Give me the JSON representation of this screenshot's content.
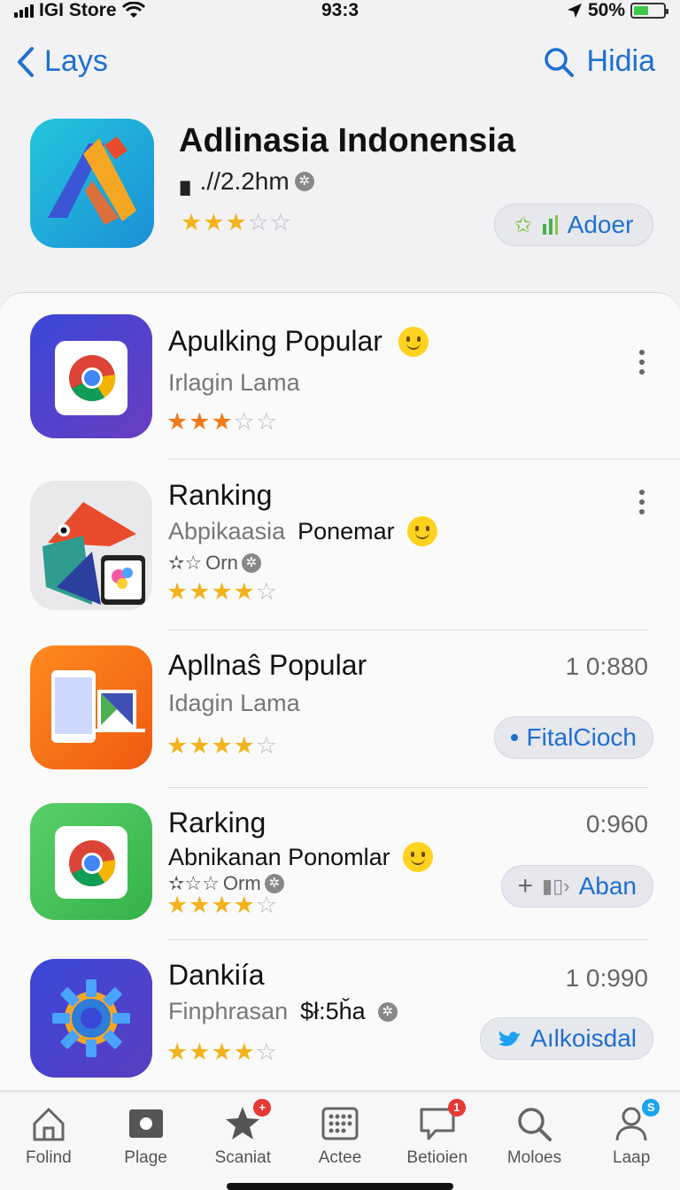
{
  "status": {
    "carrier": "IGI Store",
    "time": "93:3",
    "battery": "50%",
    "battery_level": 0.5
  },
  "nav": {
    "back_label": "Lays",
    "search_label": "Hidia"
  },
  "featured": {
    "title": "Adlinasia Indonensia",
    "meta": "▖.//2.2hm",
    "rating": 3,
    "button_label": "Adoer"
  },
  "rows": [
    {
      "title": "Apulking Popular",
      "subtitle": "Irlagin Lama",
      "rating": 3,
      "rating_color": "#f07a1a"
    },
    {
      "title": "Ranking",
      "subtitle": "Abpikaasia",
      "subtitle_dark": "Ponemar",
      "sub2": "Orn",
      "rating": 4
    },
    {
      "title": "Apllnaŝ Popular",
      "subtitle": "Idagin Lama",
      "time": "1 0:880",
      "button_label": "FitalCioch",
      "rating": 4
    },
    {
      "title": "Rarking",
      "subtitle": "Abnikanan Ponomlar",
      "sub2": "Orm",
      "time": "0:960",
      "button_label": "Aban",
      "rating": 4
    },
    {
      "title": "Dankiía",
      "subtitle": "Finphrasan",
      "subtitle_dark": "$ł:5ȟa",
      "time": "1 0:990",
      "button_label": "Aılkoisdal",
      "rating": 4
    }
  ],
  "tabs": [
    {
      "label": "Folind",
      "icon": "home-icon"
    },
    {
      "label": "Plage",
      "icon": "photo-icon"
    },
    {
      "label": "Scaniat",
      "icon": "star-icon",
      "badge": "+"
    },
    {
      "label": "Actee",
      "icon": "grid-icon"
    },
    {
      "label": "Betioien",
      "icon": "message-icon",
      "badge": "1"
    },
    {
      "label": "Moloes",
      "icon": "search-icon"
    },
    {
      "label": "Laap",
      "icon": "person-icon",
      "badge": "S"
    }
  ]
}
